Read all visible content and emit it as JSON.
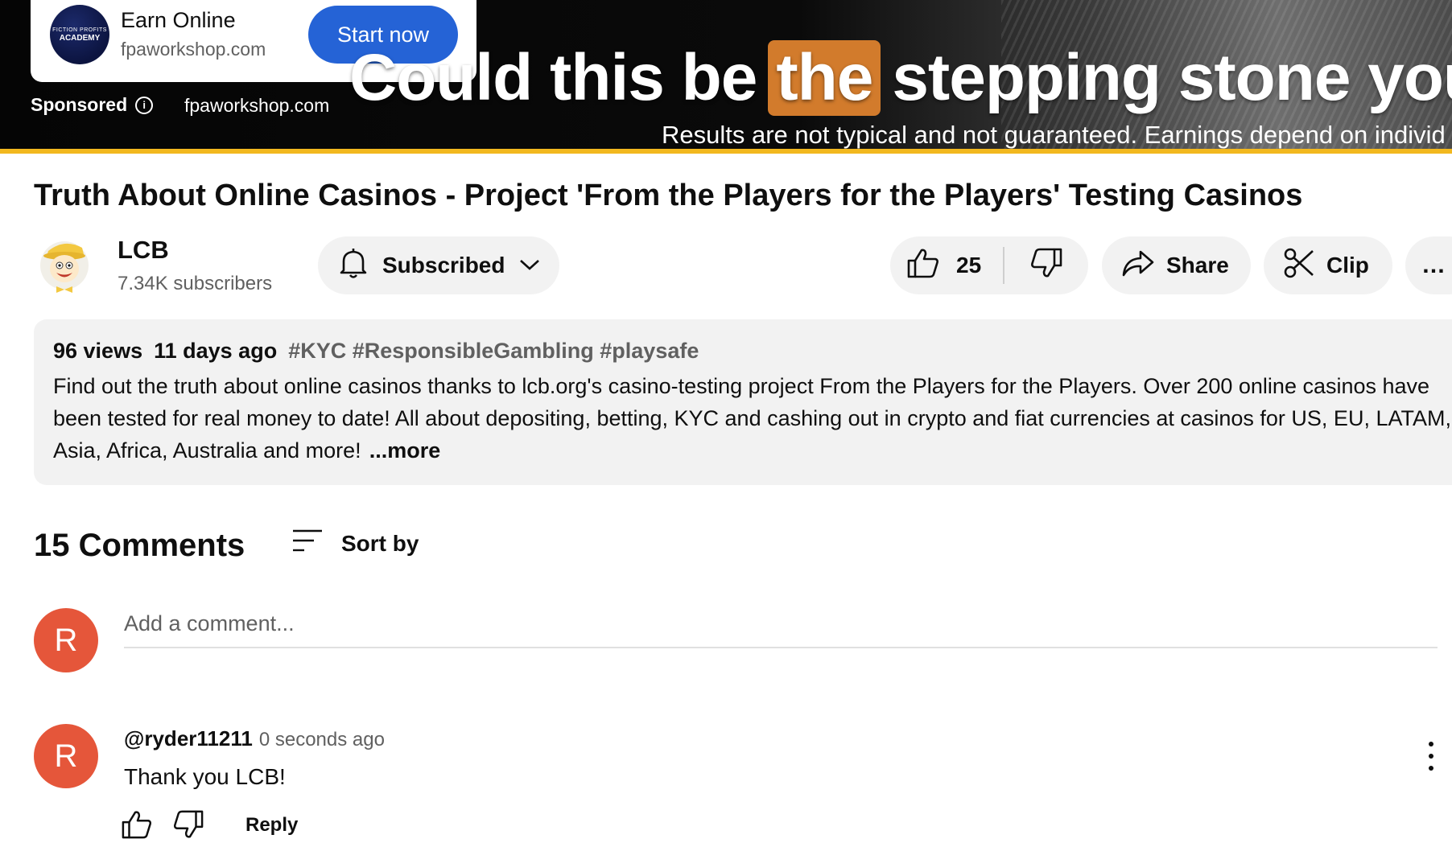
{
  "ad": {
    "logo_text_small": "FICTION PROFITS",
    "logo_text_big": "ACADEMY",
    "title": "Earn Online",
    "domain": "fpaworkshop.com",
    "cta": "Start now",
    "sponsored_label": "Sponsored",
    "banner_domain": "fpaworkshop.com",
    "headline_pre": "Could this be",
    "headline_highlight": "the",
    "headline_post": "stepping stone you r",
    "disclaimer": "Results are not typical and not guaranteed. Earnings depend on individ",
    "highlight_color": "#d27b2c",
    "cta_color": "#2563d6"
  },
  "video": {
    "title": "Truth About Online Casinos - Project 'From the Players for the Players' Testing Casinos"
  },
  "channel": {
    "name": "LCB",
    "subscribers": "7.34K subscribers",
    "subscribe_label": "Subscribed"
  },
  "actions": {
    "likes": "25",
    "share_label": "Share",
    "clip_label": "Clip",
    "more_label": "…"
  },
  "description": {
    "views": "96 views",
    "age": "11 days ago",
    "tags": "#KYC #ResponsibleGambling #playsafe",
    "text": "Find out the truth about online casinos thanks to lcb.org's casino-testing project From the Players for the Players. Over 200 online casinos have been tested for real money to date! All about depositing, betting, KYC and cashing out in crypto and fiat currencies at casinos for US, EU, LATAM, Asia, Africa, Australia and more!",
    "more_label": "...more"
  },
  "comments": {
    "count_label": "15 Comments",
    "sort_label": "Sort by",
    "user_initial": "R",
    "add_placeholder": "Add a comment...",
    "avatar_color": "#e5563a",
    "items": [
      {
        "initial": "R",
        "author": "@ryder11211",
        "time": "0 seconds ago",
        "text": "Thank you LCB!",
        "reply_label": "Reply"
      }
    ]
  }
}
